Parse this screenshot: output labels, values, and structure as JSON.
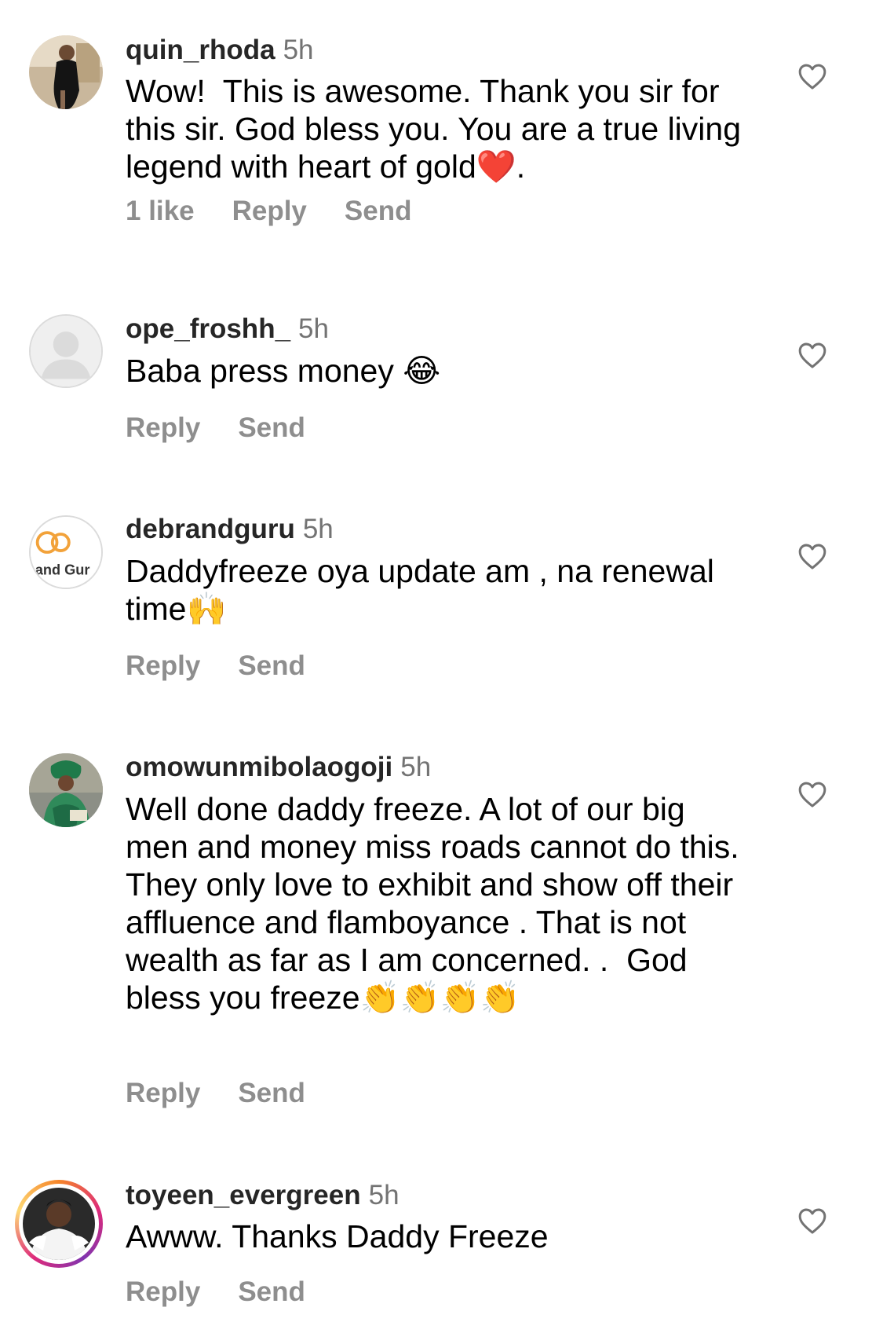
{
  "comments": [
    {
      "username": "quin_rhoda",
      "time": "5h",
      "text": "Wow!  This is awesome. Thank you sir for this sir. God bless you. You are a true living legend with heart of gold❤️.",
      "likes": "1 like",
      "reply": "Reply",
      "send": "Send",
      "avatar_icon": "photo-avatar-woman-black-dress"
    },
    {
      "username": "ope_froshh_",
      "time": "5h",
      "text": "Baba press money 😂",
      "reply": "Reply",
      "send": "Send",
      "avatar_icon": "default-avatar-icon"
    },
    {
      "username": "debrandguru",
      "time": "5h",
      "text": "Daddyfreeze oya update am , na renewal time🙌",
      "reply": "Reply",
      "send": "Send",
      "avatar_icon": "brand-logo-avatar",
      "avatar_logo_text": "and Gur"
    },
    {
      "username": "omowunmibolaogoji",
      "time": "5h",
      "text": "Well done daddy freeze. A lot of our big men and money miss roads cannot do this.  They only love to exhibit and show off their affluence and flamboyance . That is not wealth as far as I am concerned. .  God bless you freeze👏👏👏👏",
      "reply": "Reply",
      "send": "Send",
      "avatar_icon": "photo-avatar-woman-green-attire"
    },
    {
      "username": "toyeen_evergreen",
      "time": "5h",
      "text": "Awww. Thanks Daddy Freeze",
      "reply": "Reply",
      "send": "Send",
      "avatar_icon": "photo-avatar-woman-white-outfit",
      "has_story": true
    }
  ],
  "colors": {
    "username": "#262626",
    "secondary": "#737373",
    "action": "#8e8e8e",
    "story_ring": [
      "#f58529",
      "#dd2a7b",
      "#8134af",
      "#feda77"
    ]
  }
}
